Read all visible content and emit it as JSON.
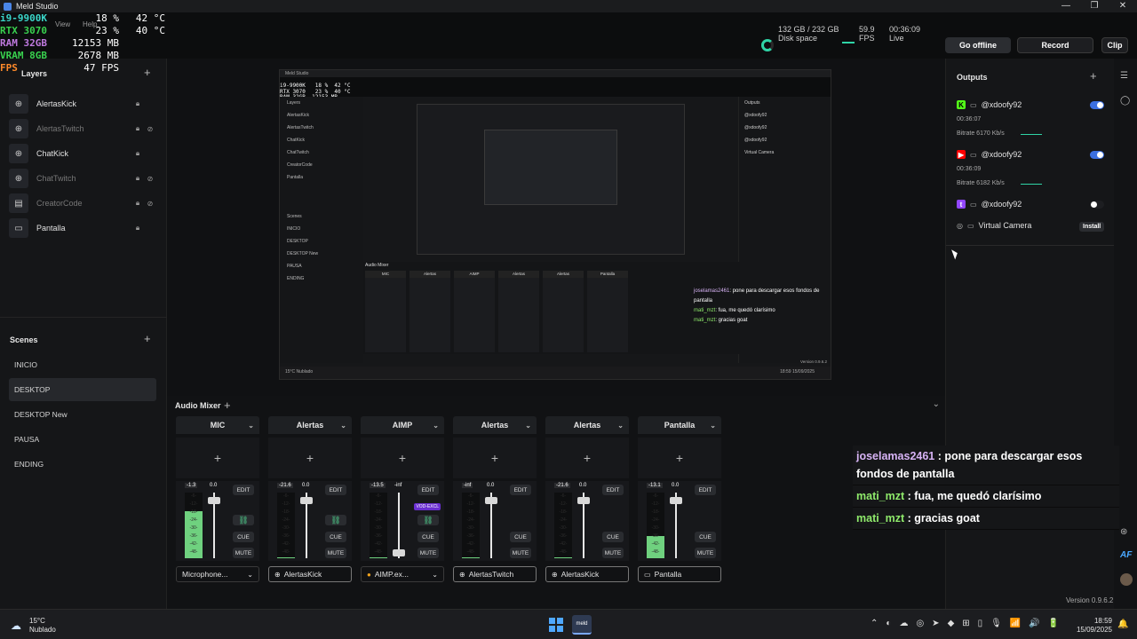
{
  "window": {
    "title": "Meld Studio",
    "controls": [
      "—",
      "❐",
      "✕"
    ]
  },
  "osd": {
    "ghost_menu": [
      "View",
      "Help"
    ],
    "rows": [
      {
        "key": "i9-9900K",
        "v1": "18 %",
        "v2": "42 °C",
        "color": "#3ad6c9"
      },
      {
        "key": "RTX 3070",
        "v1": "23 %",
        "v2": "40 °C",
        "color": "#39d14f"
      },
      {
        "key": "RAM 32GB",
        "v1": "12153 MB",
        "v2": "",
        "color": "#c07ae0"
      },
      {
        "key": "VRAM 8GB",
        "v1": "2678 MB",
        "v2": "",
        "color": "#39d14f"
      },
      {
        "key": "FPS",
        "v1": "47 FPS",
        "v2": "",
        "color": "#ff8a2a"
      }
    ]
  },
  "topbar": {
    "disk_value": "132 GB / 232 GB",
    "disk_label": "Disk space",
    "fps_value": "59.9",
    "fps_label": "FPS",
    "time_value": "00:36:09",
    "time_label": "Live",
    "go_offline": "Go offline",
    "record": "Record",
    "clip": "Clip"
  },
  "layers": {
    "title": "Layers",
    "items": [
      {
        "label": "AlertasKick",
        "icon": "⊕",
        "dim": false,
        "eye": false
      },
      {
        "label": "AlertasTwitch",
        "icon": "⊕",
        "dim": true,
        "eye": true
      },
      {
        "label": "ChatKick",
        "icon": "⊕",
        "dim": false,
        "eye": false
      },
      {
        "label": "ChatTwitch",
        "icon": "⊕",
        "dim": true,
        "eye": true
      },
      {
        "label": "CreatorCode",
        "icon": "▤",
        "dim": true,
        "eye": true
      },
      {
        "label": "Pantalla",
        "icon": "▭",
        "dim": false,
        "eye": false
      }
    ]
  },
  "scenes": {
    "title": "Scenes",
    "items": [
      {
        "label": "INICIO",
        "active": false
      },
      {
        "label": "DESKTOP",
        "active": true
      },
      {
        "label": "DESKTOP New",
        "active": false
      },
      {
        "label": "PAUSA",
        "active": false
      },
      {
        "label": "ENDING",
        "active": false
      }
    ]
  },
  "preview": {
    "title": "Meld Studio",
    "osd": "i9-9900K   18 %  42 °C\nRTX 3070   23 %  40 °C\nRAM 32GB  12153 MB\nVRAM 8GB   2678 MB\nFPS        47 FPS",
    "layers": [
      "Layers",
      "AlertasKick",
      "AlertasTwitch",
      "ChatKick",
      "ChatTwitch",
      "CreatorCode",
      "Pantalla"
    ],
    "scenes": [
      "Scenes",
      "INICIO",
      "DESKTOP",
      "DESKTOP New",
      "PAUSA",
      "ENDING"
    ],
    "outputs": [
      "Outputs",
      "@xdoofy92",
      "@xdoofy92",
      "@xdoofy92",
      "Virtual Camera"
    ],
    "channels": [
      "MIC",
      "Alertas",
      "AIMP",
      "Alertas",
      "Alertas",
      "Pantalla"
    ],
    "chat": [
      {
        "user": "joselamas2461",
        "text": ": pone para descargar esos fondos de pantalla"
      },
      {
        "user": "mati_mzt",
        "text": ": fua, me quedó clarísimo"
      },
      {
        "user": "mati_mzt",
        "text": ": gracias goat"
      }
    ],
    "mixer_title": "Audio Mixer",
    "version": "Version 0.9.6.2",
    "weather": "15°C Nublado",
    "clock": "18:59 15/09/2025"
  },
  "mixer": {
    "title": "Audio Mixer",
    "channels": [
      {
        "name": "MIC",
        "meter": "-1.3",
        "fader_val": "0.0",
        "fill": 0.72,
        "fader": 0.93,
        "link": true,
        "vod": false,
        "source": "Microphone...",
        "src_icon": "",
        "src_chev": true,
        "boxed": false
      },
      {
        "name": "Alertas",
        "meter": "-21.6",
        "fader_val": "0.0",
        "fill": 0.02,
        "fader": 0.93,
        "link": true,
        "vod": false,
        "source": "AlertasKick",
        "src_icon": "⊕",
        "src_chev": false,
        "boxed": true
      },
      {
        "name": "AIMP",
        "meter": "-13.5",
        "fader_val": "-inf",
        "fill": 0.02,
        "fader": 0.08,
        "link": true,
        "vod": true,
        "source": "AIMP.ex...",
        "src_icon": "●",
        "src_chev": true,
        "boxed": false
      },
      {
        "name": "Alertas",
        "meter": "-inf",
        "fader_val": "0.0",
        "fill": 0.02,
        "fader": 0.93,
        "link": false,
        "vod": false,
        "source": "AlertasTwitch",
        "src_icon": "⊕",
        "src_chev": false,
        "boxed": true
      },
      {
        "name": "Alertas",
        "meter": "-21.6",
        "fader_val": "0.0",
        "fill": 0.02,
        "fader": 0.93,
        "link": false,
        "vod": false,
        "source": "AlertasKick",
        "src_icon": "⊕",
        "src_chev": false,
        "boxed": true
      },
      {
        "name": "Pantalla",
        "meter": "-13.1",
        "fader_val": "0.0",
        "fill": 0.34,
        "fader": 0.93,
        "link": false,
        "vod": false,
        "source": "Pantalla",
        "src_icon": "▭",
        "src_chev": false,
        "boxed": true
      }
    ],
    "labels": {
      "edit": "EDIT",
      "cue": "CUE",
      "mute": "MUTE",
      "vod": "VOD-EXCL"
    },
    "ticks": [
      "-6-",
      "-12-",
      "-18-",
      "-24-",
      "-30-",
      "-36-",
      "-42-",
      "-48-"
    ]
  },
  "outputs": {
    "title": "Outputs",
    "items": [
      {
        "platform": "kick",
        "badge": "K",
        "color": "#53fc18",
        "name": "@xdoofy92",
        "on": true,
        "time": "00:36:07",
        "bitrate": "Bitrate  6170 Kb/s"
      },
      {
        "platform": "youtube",
        "badge": "▶",
        "color": "#ff0000",
        "name": "@xdoofy92",
        "on": true,
        "time": "00:36:09",
        "bitrate": "Bitrate  6182 Kb/s"
      },
      {
        "platform": "twitch",
        "badge": "t",
        "color": "#9146ff",
        "name": "@xdoofy92",
        "on": false,
        "time": "",
        "bitrate": ""
      }
    ],
    "virtual_camera": "Virtual Camera",
    "install": "Install",
    "accent": "#3b6fe0"
  },
  "chat": [
    {
      "user": "joselamas2461",
      "text": " : pone para descargar esos fondos de pantalla",
      "cls": "u1"
    },
    {
      "user": "mati_mzt",
      "text": " : fua, me quedó clarísimo",
      "cls": "u2"
    },
    {
      "user": "mati_mzt",
      "text": " : gracias goat",
      "cls": "u2"
    }
  ],
  "version": "Version 0.9.6.2",
  "taskbar": {
    "temp": "15°C",
    "weather": "Nublado",
    "meld_label": "meld",
    "time": "18:59",
    "date": "15/09/2025",
    "tray_icons": [
      "⌃",
      "◐",
      "☁",
      "◎",
      "➤",
      "◆",
      "⊞",
      "▯",
      "🎙",
      "📶",
      "🔊",
      "🔋"
    ]
  }
}
